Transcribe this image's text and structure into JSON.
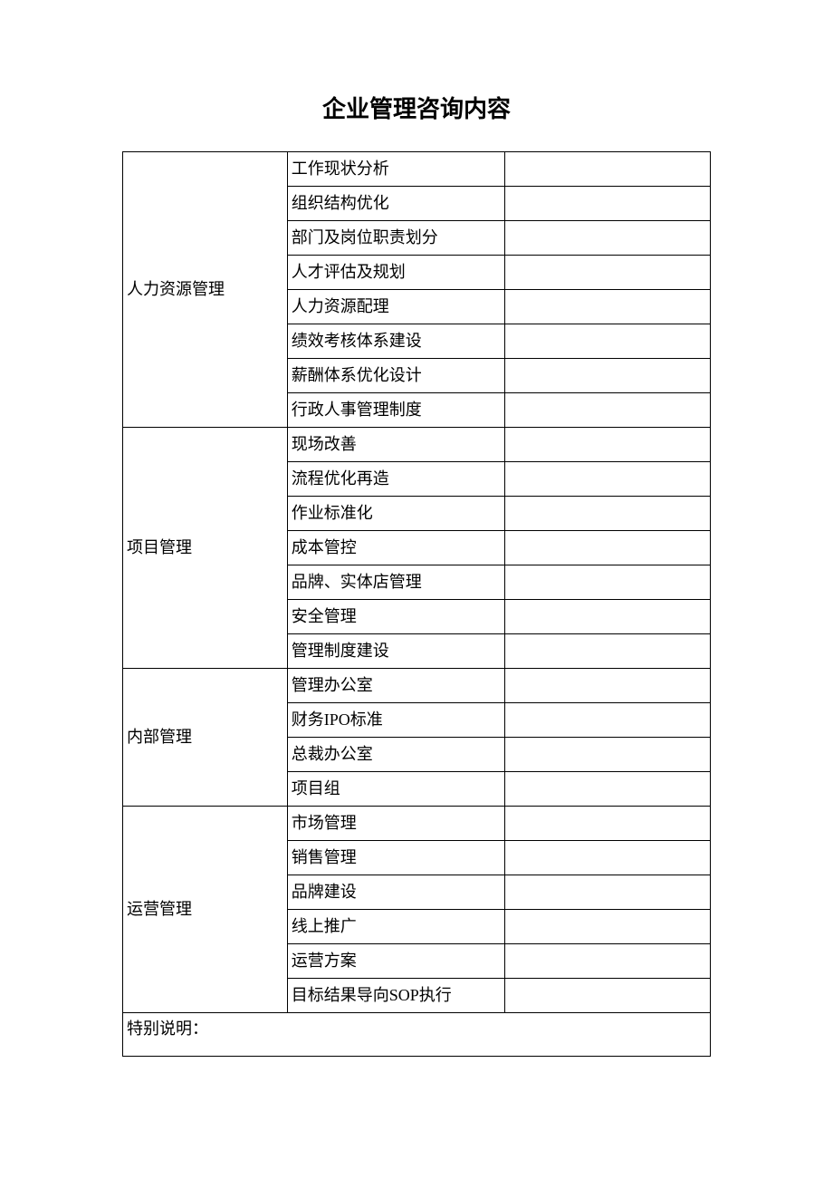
{
  "title": "企业管理咨询内容",
  "sections": [
    {
      "category": "人力资源管理",
      "items": [
        "工作现状分析",
        "组织结构优化",
        "部门及岗位职责划分",
        "人才评估及规划",
        "人力资源配理",
        "绩效考核体系建设",
        "薪酬体系优化设计",
        "行政人事管理制度"
      ]
    },
    {
      "category": "项目管理",
      "items": [
        "现场改善",
        "流程优化再造",
        "作业标准化",
        "成本管控",
        "品牌、实体店管理",
        "安全管理",
        "管理制度建设"
      ]
    },
    {
      "category": "内部管理",
      "items": [
        "管理办公室",
        "财务IPO标准",
        "总裁办公室",
        "项目组"
      ]
    },
    {
      "category": "运营管理",
      "items": [
        "市场管理",
        "销售管理",
        "品牌建设",
        "线上推广",
        "运营方案",
        "目标结果导向SOP执行"
      ]
    }
  ],
  "footer": "特别说明："
}
